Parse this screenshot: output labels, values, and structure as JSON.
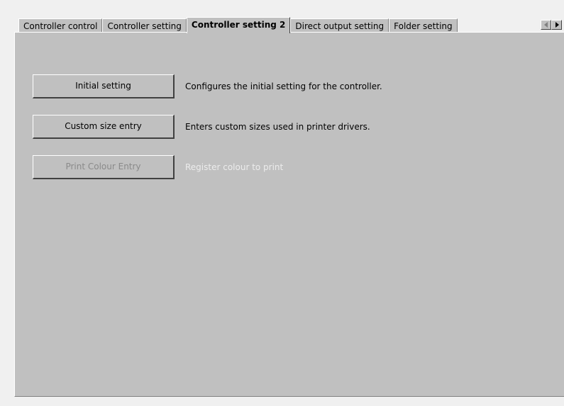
{
  "tabs": [
    {
      "label": "Controller control",
      "active": false
    },
    {
      "label": "Controller setting",
      "active": false
    },
    {
      "label": "Controller setting 2",
      "active": true
    },
    {
      "label": "Direct output setting",
      "active": false
    },
    {
      "label": "Folder setting",
      "active": false
    }
  ],
  "tab_scroll": {
    "left_icon": "arrow-left-icon",
    "right_icon": "arrow-right-icon"
  },
  "actions": [
    {
      "button_label": "Initial setting",
      "description": "Configures the initial setting for the controller.",
      "enabled": true
    },
    {
      "button_label": "Custom size entry",
      "description": "Enters custom sizes used in printer drivers.",
      "enabled": true
    },
    {
      "button_label": "Print Colour Entry",
      "description": "Register colour to print",
      "enabled": false
    }
  ],
  "colors": {
    "panel_bg": "#c0c0c0",
    "window_bg": "#f0f0f0",
    "disabled_text": "#8a8a8a"
  }
}
